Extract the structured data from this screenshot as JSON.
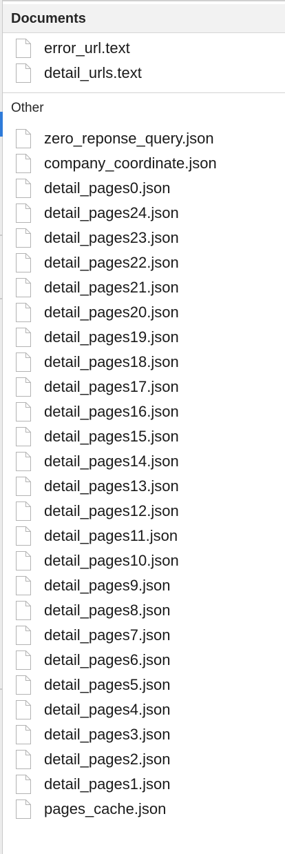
{
  "documents": {
    "header": "Documents",
    "files": [
      "error_url.text",
      "detail_urls.text"
    ]
  },
  "other": {
    "header": "Other",
    "files": [
      "zero_reponse_query.json",
      "company_coordinate.json",
      "detail_pages0.json",
      "detail_pages24.json",
      "detail_pages23.json",
      "detail_pages22.json",
      "detail_pages21.json",
      "detail_pages20.json",
      "detail_pages19.json",
      "detail_pages18.json",
      "detail_pages17.json",
      "detail_pages16.json",
      "detail_pages15.json",
      "detail_pages14.json",
      "detail_pages13.json",
      "detail_pages12.json",
      "detail_pages11.json",
      "detail_pages10.json",
      "detail_pages9.json",
      "detail_pages8.json",
      "detail_pages7.json",
      "detail_pages6.json",
      "detail_pages5.json",
      "detail_pages4.json",
      "detail_pages3.json",
      "detail_pages2.json",
      "detail_pages1.json",
      "pages_cache.json"
    ]
  },
  "icons": {
    "file": "document-icon"
  },
  "colors": {
    "selection_accent": "#2f7bd9",
    "header_bg": "#f2f2f2"
  }
}
